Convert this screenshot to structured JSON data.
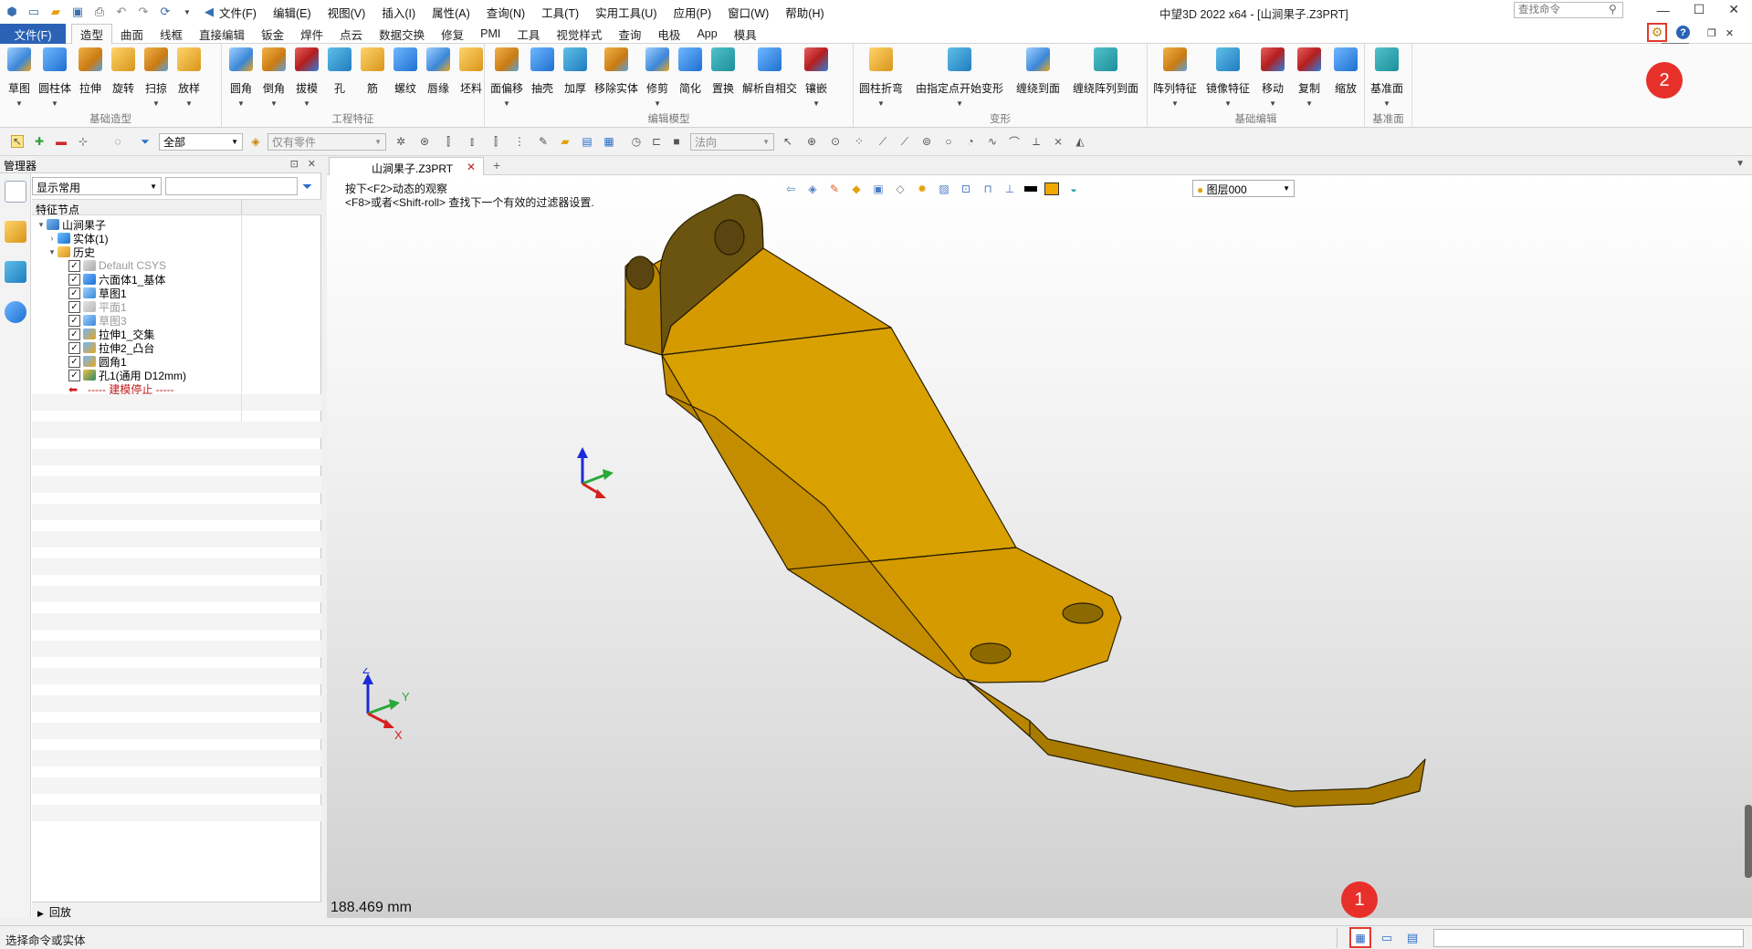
{
  "titlebar": {
    "window_title": "中望3D 2022 x64 - [山涧果子.Z3PRT]",
    "menus": [
      "文件(F)",
      "编辑(E)",
      "视图(V)",
      "插入(I)",
      "属性(A)",
      "查询(N)",
      "工具(T)",
      "实用工具(U)",
      "应用(P)",
      "窗口(W)",
      "帮助(H)"
    ]
  },
  "ribbon": {
    "file_tab": "文件(F)",
    "tabs": [
      "造型",
      "曲面",
      "线框",
      "直接编辑",
      "钣金",
      "焊件",
      "点云",
      "数据交换",
      "修复",
      "PMI",
      "工具",
      "视觉样式",
      "查询",
      "电极",
      "App",
      "模具"
    ],
    "active_tab": "造型",
    "search_placeholder": "查找命令",
    "config_tooltip": "配置",
    "groups": [
      {
        "name": "基础造型",
        "buttons": [
          "草图",
          "圆柱体",
          "拉伸",
          "旋转",
          "扫掠",
          "放样"
        ]
      },
      {
        "name": "工程特征",
        "buttons": [
          "圆角",
          "倒角",
          "拔模",
          "孔",
          "筋",
          "螺纹",
          "唇缘",
          "坯料"
        ]
      },
      {
        "name": "编辑模型",
        "buttons": [
          "面偏移",
          "抽壳",
          "加厚",
          "移除实体",
          "修剪",
          "简化",
          "置换",
          "解析自相交",
          "镶嵌"
        ]
      },
      {
        "name": "变形",
        "buttons": [
          "圆柱折弯",
          "由指定点开始变形",
          "缠绕到面",
          "缠绕阵列到面"
        ]
      },
      {
        "name": "基础编辑",
        "buttons": [
          "阵列特征",
          "镜像特征",
          "移动",
          "复制",
          "缩放"
        ]
      },
      {
        "name": "基准面",
        "buttons": [
          "基准面"
        ]
      }
    ]
  },
  "toolbar2": {
    "filter_all": "全部",
    "parts_only": "仅有零件",
    "normal": "法向"
  },
  "manager": {
    "title": "管理器",
    "display_filter": "显示常用",
    "tree_header": "特征节点",
    "playback": "回放",
    "tree": [
      {
        "label": "山涧果子",
        "level": 0,
        "twisty": "▾",
        "icon": "assembly-icon",
        "checked": null,
        "dim": false
      },
      {
        "label": "实体(1)",
        "level": 1,
        "twisty": "›",
        "icon": "solid-icon",
        "checked": null,
        "dim": false
      },
      {
        "label": "历史",
        "level": 1,
        "twisty": "▾",
        "icon": "history-folder-icon",
        "checked": null,
        "dim": false
      },
      {
        "label": "Default CSYS",
        "level": 2,
        "twisty": "",
        "icon": "csys-icon",
        "checked": true,
        "dim": true
      },
      {
        "label": "六面体1_基体",
        "level": 2,
        "twisty": "",
        "icon": "block-icon",
        "checked": true,
        "dim": false
      },
      {
        "label": "草图1",
        "level": 2,
        "twisty": "",
        "icon": "sketch-icon",
        "checked": true,
        "dim": false
      },
      {
        "label": "平面1",
        "level": 2,
        "twisty": "",
        "icon": "plane-icon",
        "checked": true,
        "dim": true
      },
      {
        "label": "草图3",
        "level": 2,
        "twisty": "",
        "icon": "sketch-icon",
        "checked": true,
        "dim": true
      },
      {
        "label": "拉伸1_交集",
        "level": 2,
        "twisty": "",
        "icon": "extrude-icon",
        "checked": true,
        "dim": false
      },
      {
        "label": "拉伸2_凸台",
        "level": 2,
        "twisty": "",
        "icon": "extrude-icon",
        "checked": true,
        "dim": false
      },
      {
        "label": "圆角1",
        "level": 2,
        "twisty": "",
        "icon": "fillet-icon",
        "checked": true,
        "dim": false
      },
      {
        "label": "孔1(通用 D12mm)",
        "level": 2,
        "twisty": "",
        "icon": "hole-icon",
        "checked": true,
        "dim": false
      },
      {
        "label": "----- 建模停止 -----",
        "level": 2,
        "twisty": "",
        "icon": "stop-arrow-icon",
        "checked": null,
        "dim": false,
        "stop": true
      }
    ]
  },
  "document": {
    "tab_name": "山涧果子.Z3PRT",
    "hint_line1": "按下<F2>动态的观察",
    "hint_line2": "<F8>或者<Shift-roll> 查找下一个有效的过滤器设置.",
    "layer": "图层000",
    "scale_readout": "188.469 mm",
    "axis_labels": {
      "x": "X",
      "y": "Y",
      "z": "Z"
    },
    "part_color": "#D49A00"
  },
  "status": {
    "text": "选择命令或实体"
  },
  "callouts": [
    "1",
    "2"
  ],
  "colors": {
    "accent": "#2B62B5",
    "highlight": "#E8302A"
  }
}
